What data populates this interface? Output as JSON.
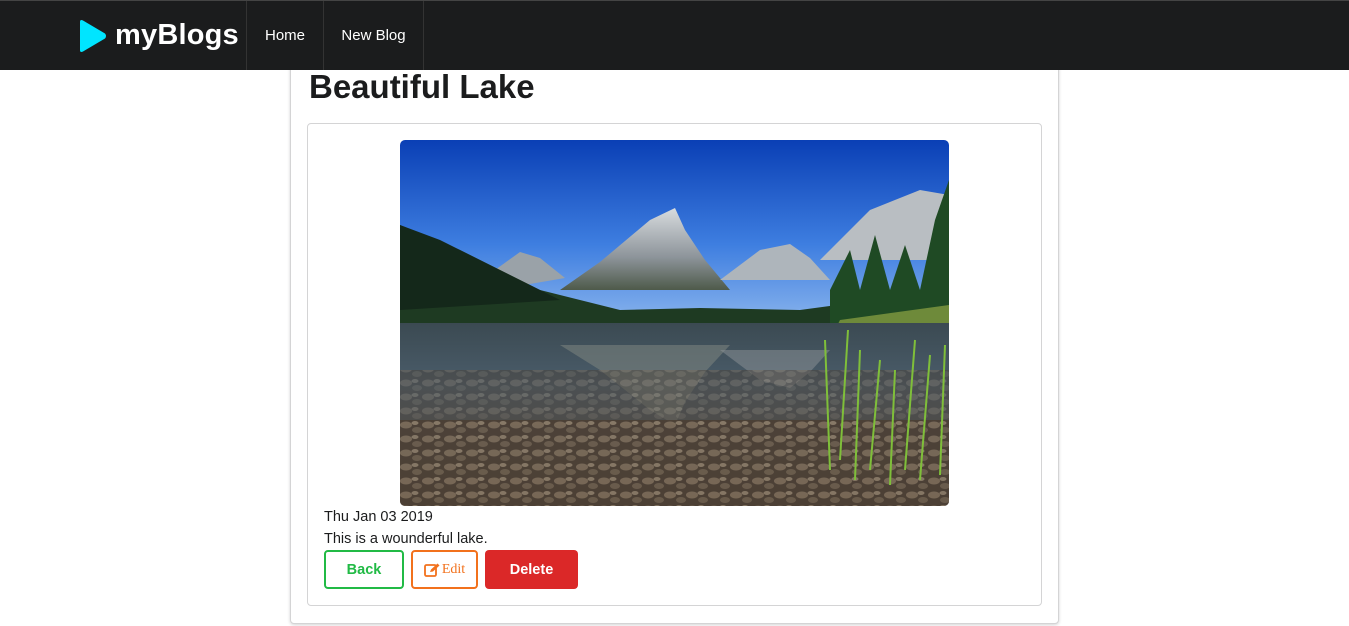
{
  "navbar": {
    "brand": "myBlogs",
    "brand_icon": "play-icon",
    "brand_icon_color": "#00e5ff",
    "background": "#1b1c1d",
    "items": [
      {
        "label": "Home"
      },
      {
        "label": "New Blog"
      }
    ]
  },
  "post": {
    "title": "Beautiful Lake",
    "image_alt": "mountain-lake-photo",
    "date": "Thu Jan 03 2019",
    "body": "This is a wounderful lake."
  },
  "actions": {
    "back_label": "Back",
    "edit_label": "Edit",
    "edit_icon": "edit-icon",
    "delete_label": "Delete",
    "colors": {
      "back": "#21ba45",
      "edit": "#f2711c",
      "delete": "#db2828"
    }
  }
}
